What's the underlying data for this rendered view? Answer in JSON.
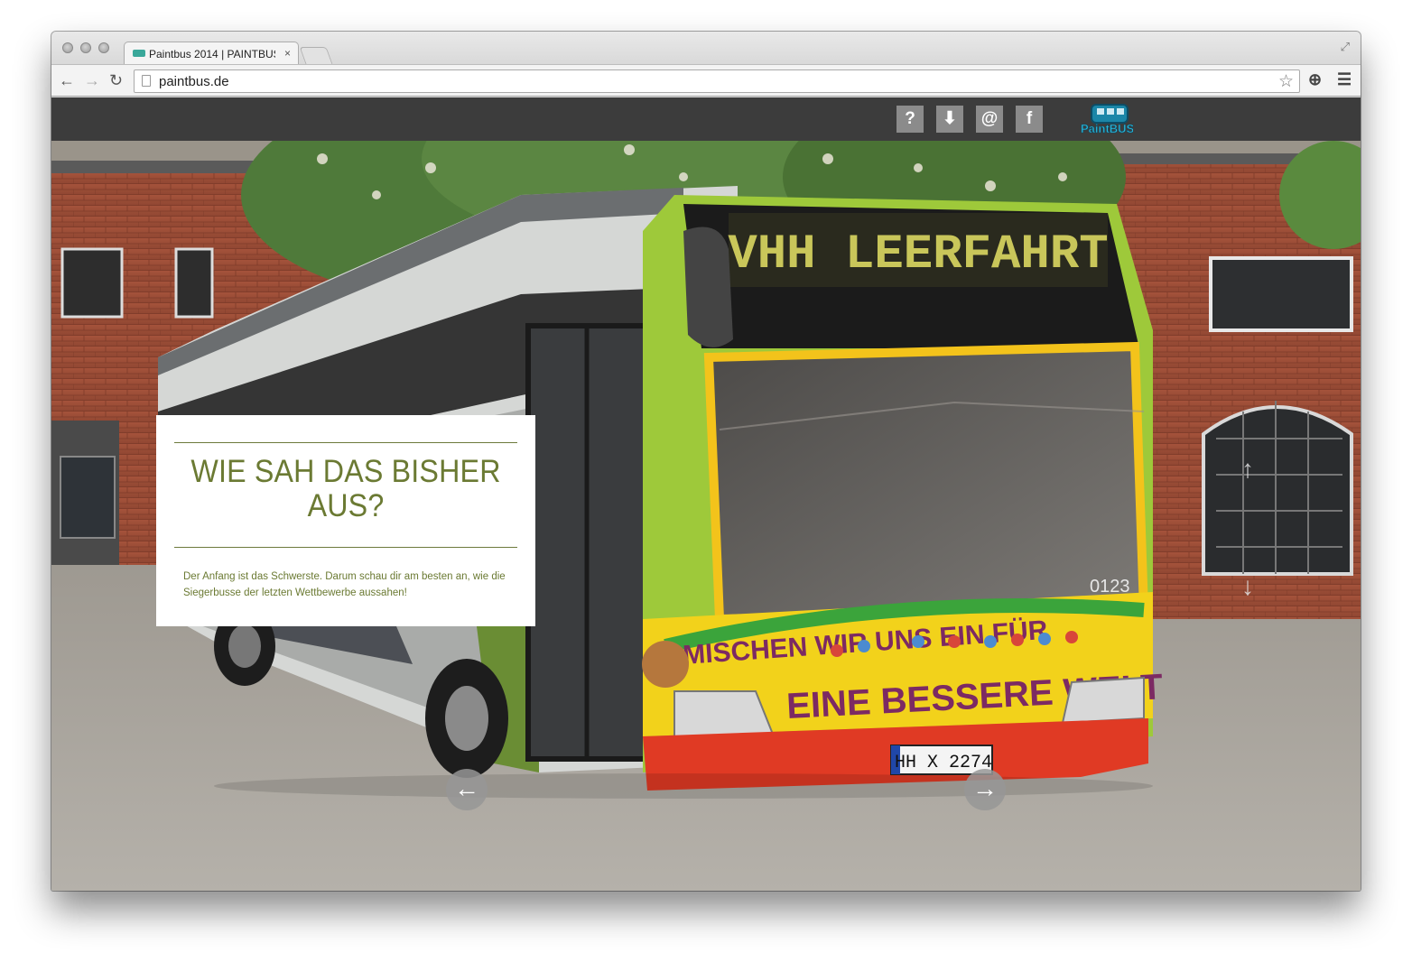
{
  "browser": {
    "tab_title": "Paintbus 2014 | PAINTBUS",
    "tab_close": "×",
    "url": "paintbus.de",
    "back": "←",
    "forward": "→",
    "reload": "↻",
    "bookmark_star": "☆",
    "menu": "☰",
    "extension": "⊕",
    "fullscreen": "⤢"
  },
  "header": {
    "icons": [
      {
        "glyph": "?",
        "name": "help-icon"
      },
      {
        "glyph": "⬇",
        "name": "download-icon"
      },
      {
        "glyph": "@",
        "name": "email-icon"
      },
      {
        "glyph": "f",
        "name": "facebook-icon"
      }
    ],
    "logo_text": "PaintBUS"
  },
  "hero": {
    "destination_sign": "VHH LEERFAHRT",
    "bus_slogan_1": "MISCHEN WIR UNS EIN FÜR",
    "bus_slogan_2": "EINE BESSERE WELT",
    "license_plate": "HH X 2274",
    "bus_number": "0123",
    "prev_arrow": "←",
    "next_arrow": "→",
    "up_arrow": "↑",
    "down_arrow": "↓"
  },
  "info": {
    "title_line1": "WIE SAH DAS BISHER",
    "title_line2": "AUS?",
    "text": "Der Anfang ist das Schwerste. Darum schau dir am besten an, wie die Siegerbusse der letzten Wettbewerbe aussahen!"
  },
  "colors": {
    "accent": "#6b7a33",
    "header_bg": "#3c3c3c",
    "icon_bg": "#8b8b8b"
  }
}
